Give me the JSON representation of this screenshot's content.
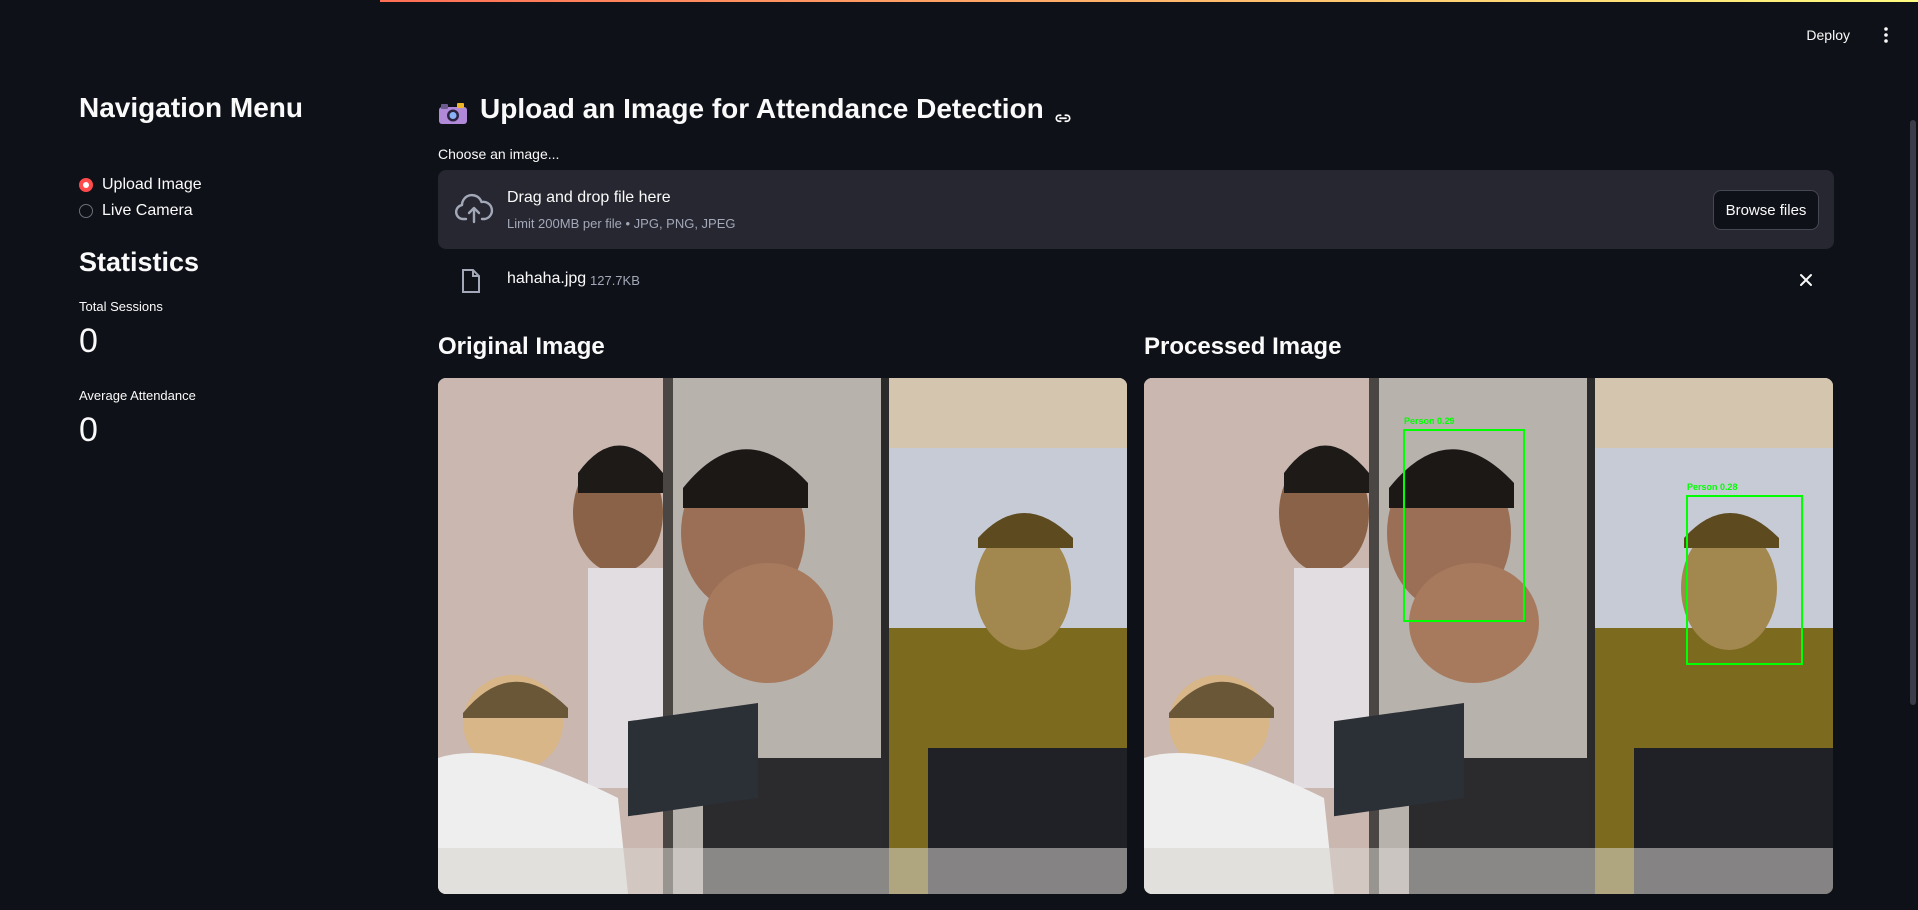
{
  "toolbar": {
    "deploy_label": "Deploy",
    "menu_icon": "kebab-menu-icon"
  },
  "sidebar": {
    "title": "Navigation Menu",
    "options": [
      {
        "label": "Upload Image",
        "selected": true
      },
      {
        "label": "Live Camera",
        "selected": false
      }
    ],
    "statistics_title": "Statistics",
    "metrics": [
      {
        "label": "Total Sessions",
        "value": "0"
      },
      {
        "label": "Average Attendance",
        "value": "0"
      }
    ]
  },
  "main": {
    "title": "Upload an Image for Attendance Detection",
    "title_icon": "camera-emoji",
    "uploader": {
      "label": "Choose an image...",
      "drop_text": "Drag and drop file here",
      "limit_text": "Limit 200MB per file • JPG, PNG, JPEG",
      "browse_label": "Browse files"
    },
    "file": {
      "name": "hahaha.jpg",
      "size": "127.7KB"
    },
    "original_title": "Original Image",
    "processed_title": "Processed Image",
    "detections": [
      {
        "label": "Person 0.29"
      },
      {
        "label": "Person 0.28"
      }
    ]
  },
  "colors": {
    "background": "#0e1117",
    "accent": "#ff4b4b",
    "panel": "#262730",
    "detection_box": "#00ff00"
  }
}
